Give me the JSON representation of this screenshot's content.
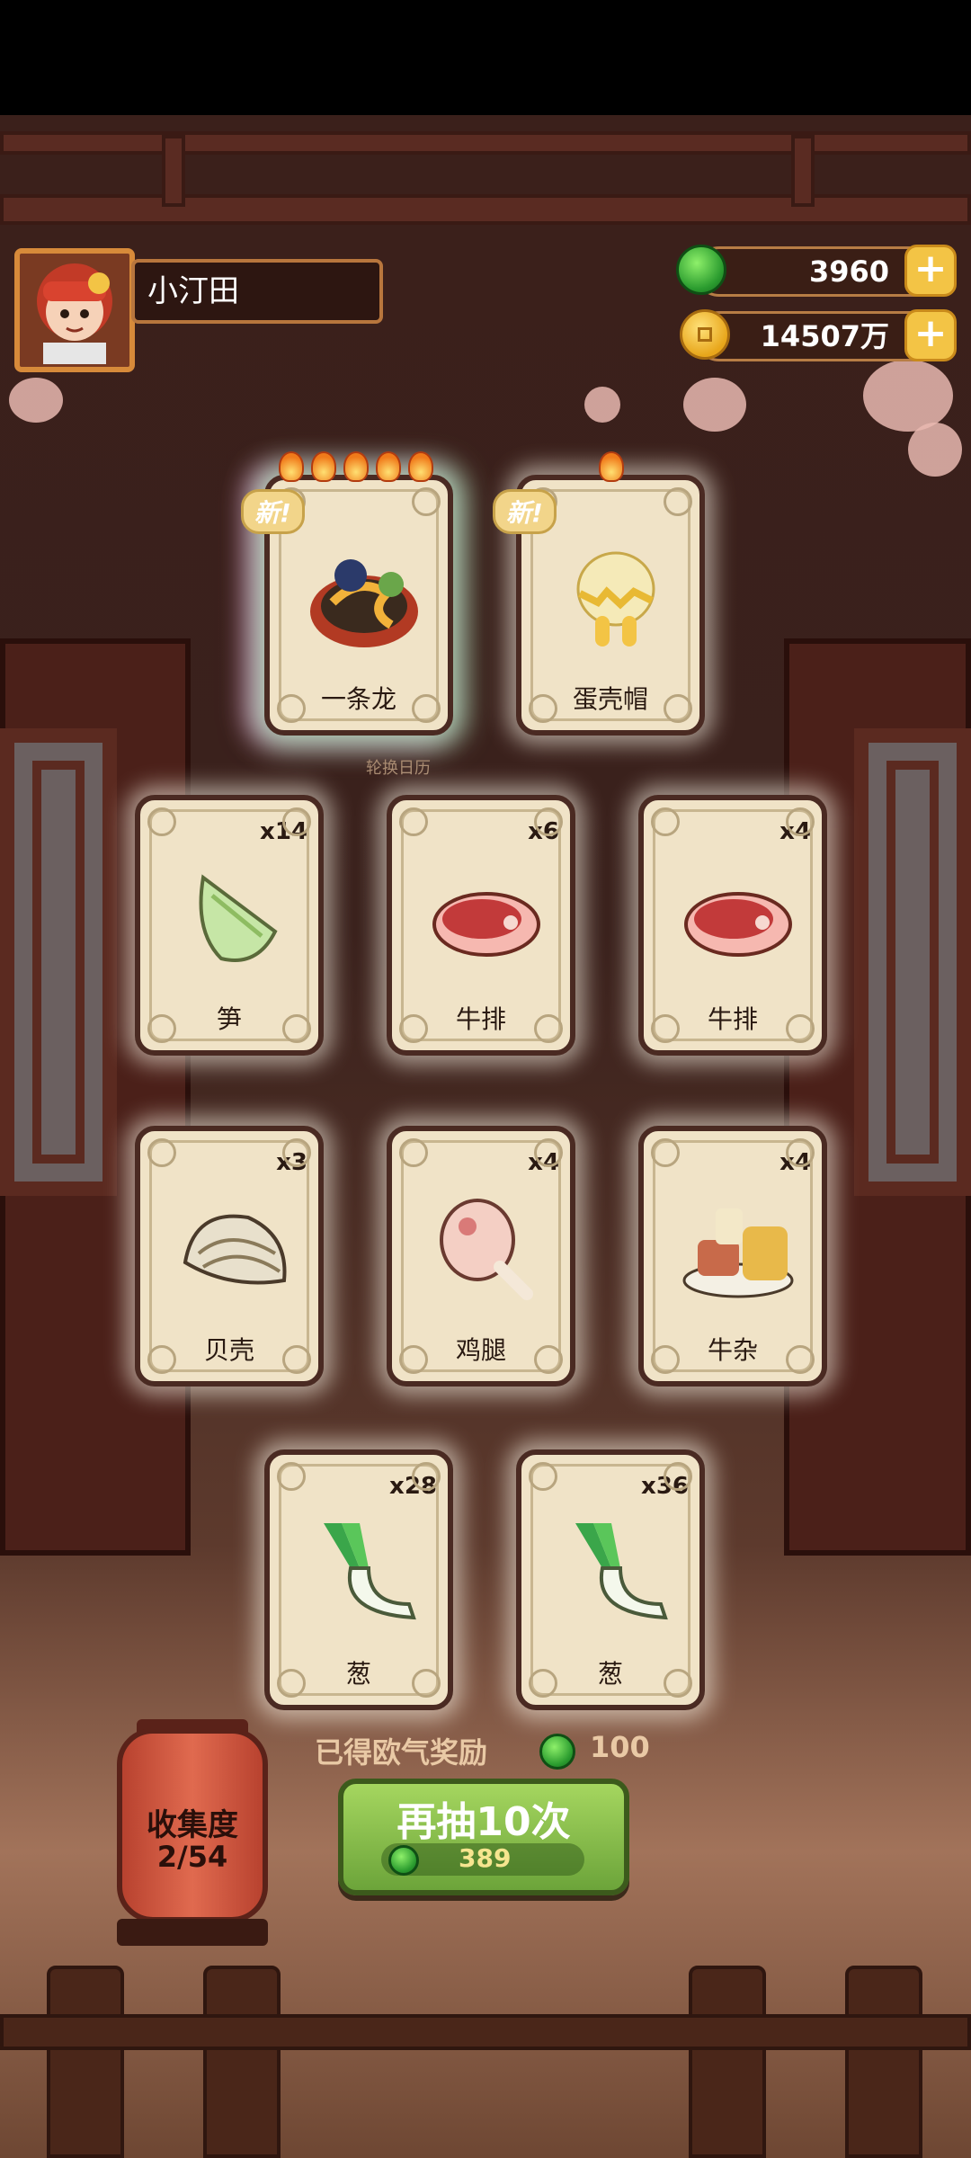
{
  "player": {
    "name": "小汀田"
  },
  "currency": {
    "jade": "3960",
    "coins": "14507万"
  },
  "icons": {
    "jade": "jade-icon",
    "coin": "coin-icon",
    "plus": "plus-icon",
    "flame": "flame-icon"
  },
  "featured_cards": [
    {
      "label": "一条龙",
      "new_tag": "新",
      "stars": 5
    },
    {
      "label": "蛋壳帽",
      "new_tag": "新",
      "stars": 1
    }
  ],
  "cards": [
    {
      "label": "笋",
      "qty": "x14"
    },
    {
      "label": "牛排",
      "qty": "x6"
    },
    {
      "label": "牛排",
      "qty": "x4"
    },
    {
      "label": "贝壳",
      "qty": "x3"
    },
    {
      "label": "鸡腿",
      "qty": "x4"
    },
    {
      "label": "牛杂",
      "qty": "x4"
    },
    {
      "label": "葱",
      "qty": "x28"
    },
    {
      "label": "葱",
      "qty": "x36"
    }
  ],
  "background_sign": "轮换日历",
  "reward": {
    "label": "已得欧气奖励",
    "value": "100"
  },
  "draw_button": {
    "label": "再抽10次",
    "cost": "389"
  },
  "collection": {
    "title": "收集度",
    "value": "2/54"
  },
  "colors": {
    "button_green": "#8bc34a",
    "card_bg": "#f0e3c7",
    "wood": "#4a2619"
  }
}
